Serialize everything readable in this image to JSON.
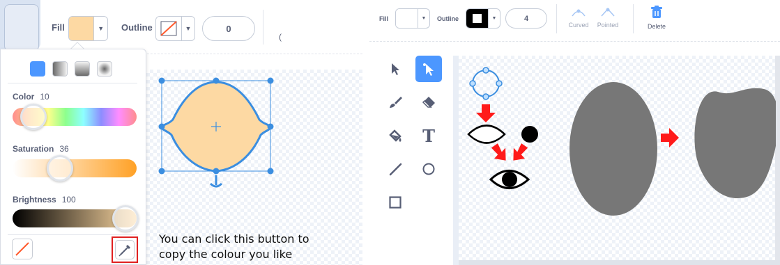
{
  "left": {
    "toolbar": {
      "fill_label": "Fill",
      "fill_color": "#fdd9a3",
      "outline_label": "Outline",
      "outline_width": "0",
      "cut_char": "("
    },
    "color_picker": {
      "gradient_types": [
        "solid",
        "horizontal-gradient",
        "vertical-gradient",
        "radial-gradient"
      ],
      "color_label": "Color",
      "color_value": "10",
      "saturation_label": "Saturation",
      "saturation_value": "36",
      "brightness_label": "Brightness",
      "brightness_value": "100"
    },
    "note": {
      "line1": "You can click this button to",
      "line2": "copy the colour you like"
    }
  },
  "right": {
    "toolbar": {
      "fill_label": "Fill",
      "outline_label": "Outline",
      "outline_color": "#000000",
      "outline_width": "4",
      "curved_label": "Curved",
      "pointed_label": "Pointed",
      "delete_label": "Delete"
    },
    "tools": [
      "select-tool",
      "reshape-tool",
      "brush-tool",
      "eraser-tool",
      "fill-tool",
      "text-tool",
      "line-tool",
      "circle-tool",
      "rectangle-tool"
    ],
    "text_tool_glyph": "T"
  },
  "colors": {
    "accent": "#4c97ff",
    "shape_fill": "#fdd9a3",
    "shape_outline": "#3b8ee0",
    "arrow_red": "#ff1a1a",
    "gray_shape": "#777777",
    "highlight_box": "#e02020"
  }
}
